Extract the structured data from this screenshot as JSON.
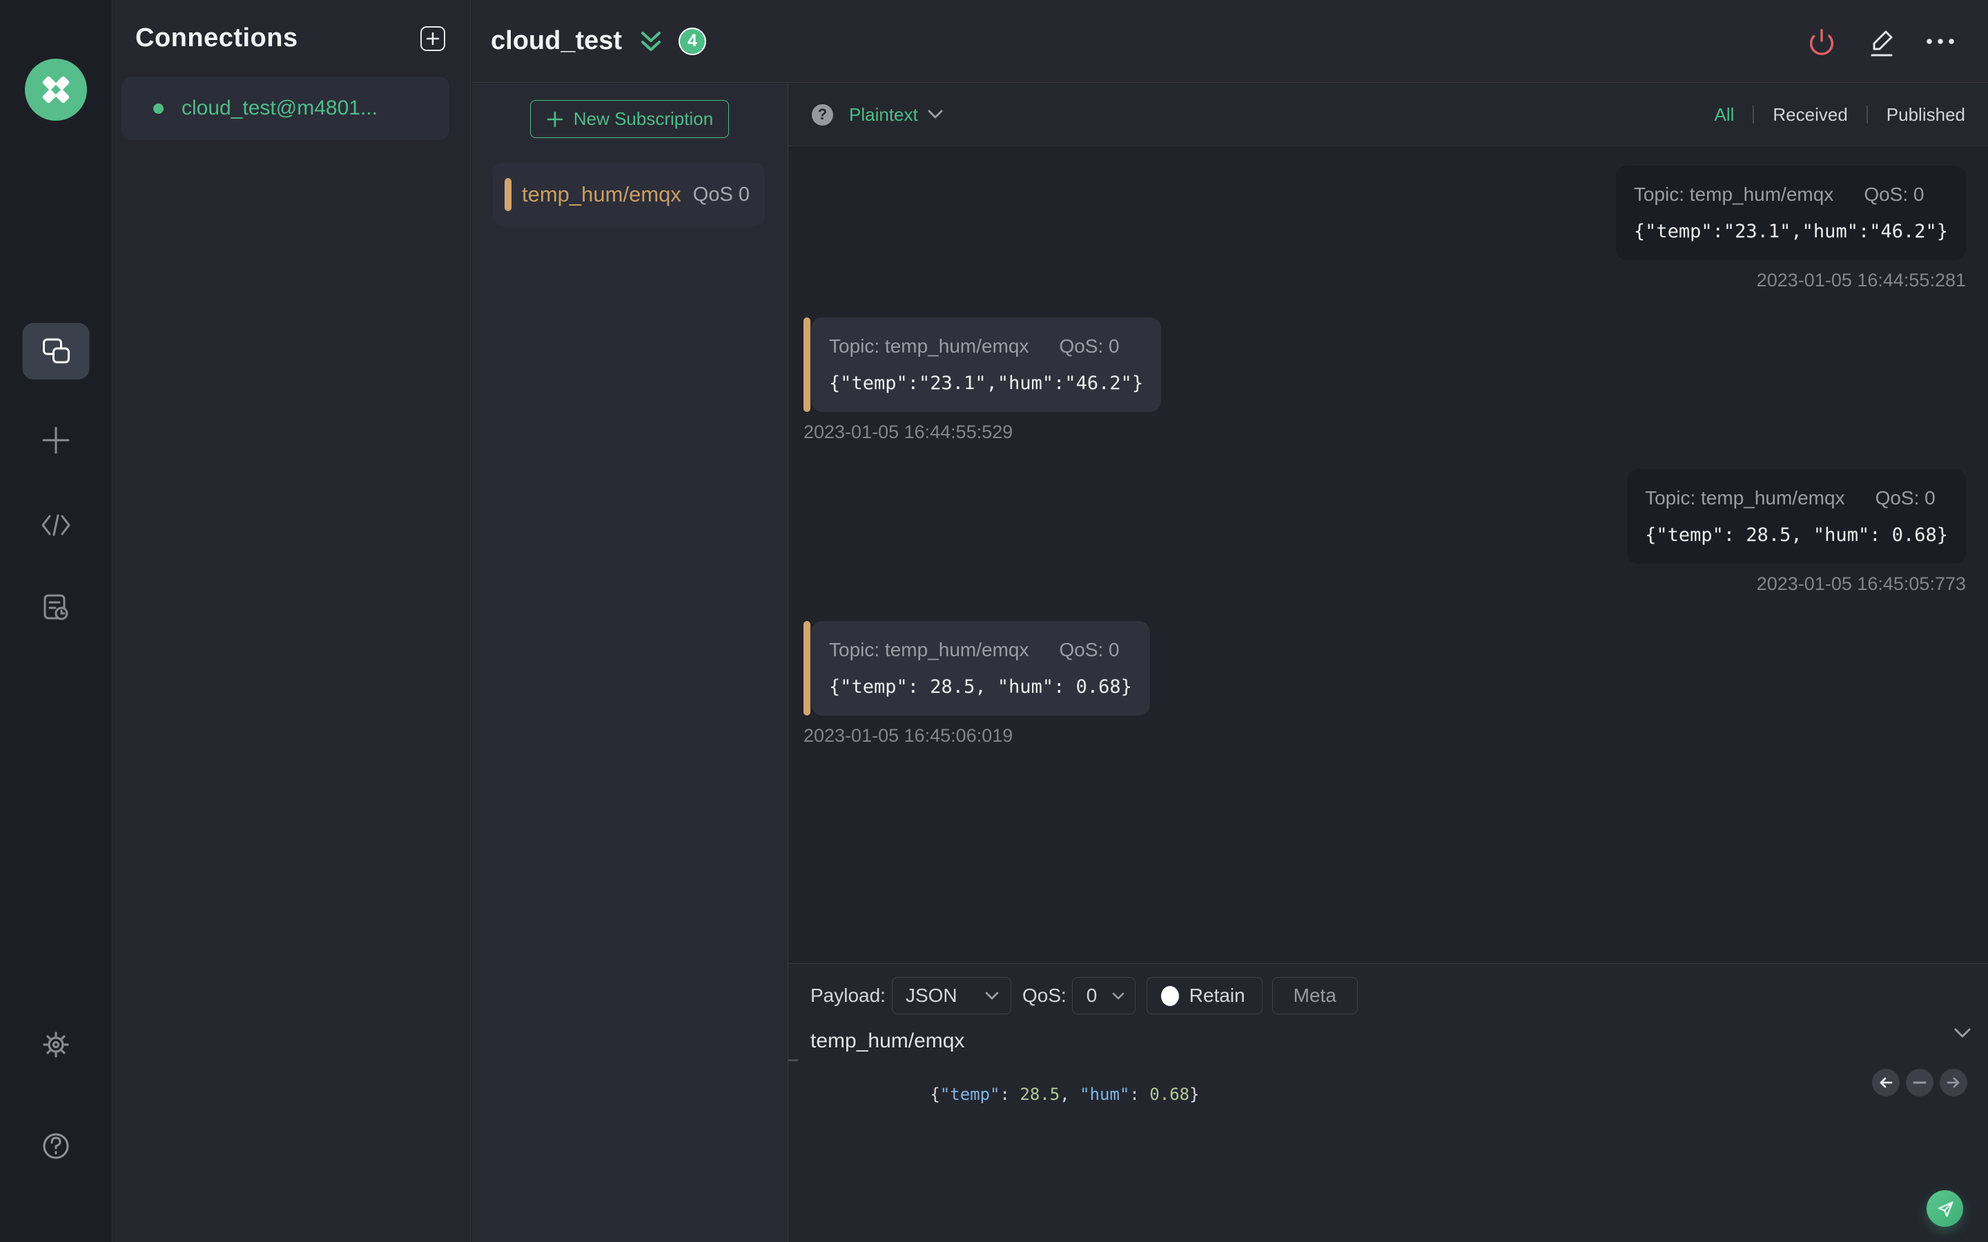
{
  "colors": {
    "accent_green": "#4ebd87",
    "topic_orange": "#cb9e62",
    "power_red": "#e06363"
  },
  "connections_panel": {
    "title": "Connections",
    "items": [
      {
        "name": "cloud_test@m4801...",
        "connected": true
      }
    ]
  },
  "header": {
    "title": "cloud_test",
    "badge_count": "4"
  },
  "subscriptions": {
    "new_label": "New Subscription",
    "items": [
      {
        "topic": "temp_hum/emqx",
        "qos": "QoS 0"
      }
    ]
  },
  "messages_panel": {
    "help_glyph": "?",
    "format": "Plaintext",
    "filters": [
      {
        "label": "All"
      },
      {
        "label": "Received"
      },
      {
        "label": "Published"
      }
    ],
    "items": [
      {
        "direction": "published",
        "topic_label": "Topic: temp_hum/emqx",
        "qos_label": "QoS: 0",
        "payload": "{\"temp\":\"23.1\",\"hum\":\"46.2\"}",
        "timestamp": "2023-01-05 16:44:55:281"
      },
      {
        "direction": "received",
        "topic_label": "Topic: temp_hum/emqx",
        "qos_label": "QoS: 0",
        "payload": "{\"temp\":\"23.1\",\"hum\":\"46.2\"}",
        "timestamp": "2023-01-05 16:44:55:529"
      },
      {
        "direction": "published",
        "topic_label": "Topic: temp_hum/emqx",
        "qos_label": "QoS: 0",
        "payload": "{\"temp\": 28.5, \"hum\": 0.68}",
        "timestamp": "2023-01-05 16:45:05:773"
      },
      {
        "direction": "received",
        "topic_label": "Topic: temp_hum/emqx",
        "qos_label": "QoS: 0",
        "payload": "{\"temp\": 28.5, \"hum\": 0.68}",
        "timestamp": "2023-01-05 16:45:06:019"
      }
    ]
  },
  "publish": {
    "payload_label": "Payload:",
    "payload_type": "JSON",
    "qos_label": "QoS:",
    "qos_value": "0",
    "retain_label": "Retain",
    "meta_label": "Meta",
    "topic": "temp_hum/emqx",
    "payload_tokens": [
      {
        "text": "{"
      },
      {
        "text": "\"temp\""
      },
      {
        "text": ": "
      },
      {
        "text": "28.5"
      },
      {
        "text": ", "
      },
      {
        "text": "\"hum\""
      },
      {
        "text": ": "
      },
      {
        "text": "0.68"
      },
      {
        "text": "}"
      }
    ]
  }
}
